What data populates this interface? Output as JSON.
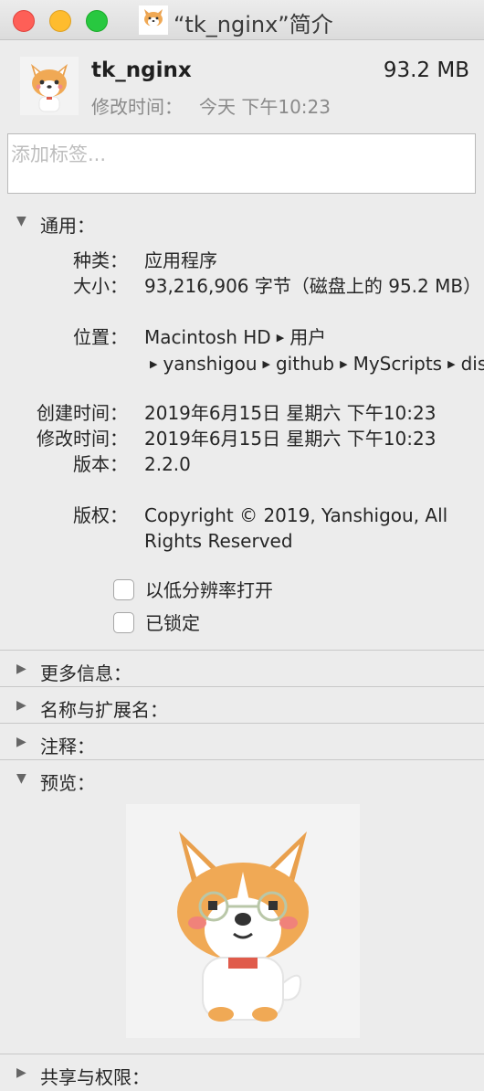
{
  "window": {
    "title": "“tk_nginx”简介"
  },
  "header": {
    "name": "tk_nginx",
    "size": "93.2 MB",
    "modified_label": "修改时间：",
    "modified_value": "今天 下午10:23"
  },
  "tags": {
    "placeholder": "添加标签..."
  },
  "sections": {
    "general": "通用：",
    "more_info": "更多信息：",
    "name_ext": "名称与扩展名：",
    "comments": "注释：",
    "preview": "预览：",
    "sharing": "共享与权限："
  },
  "general": {
    "kind_label": "种类：",
    "kind": "应用程序",
    "size_label": "大小：",
    "size": "93,216,906 字节（磁盘上的 95.2 MB）",
    "where_label": "位置：",
    "where_path": [
      "Macintosh HD",
      "用户",
      "yanshigou",
      "github",
      "MyScripts",
      "dist"
    ],
    "created_label": "创建时间：",
    "created": "2019年6月15日 星期六 下午10:23",
    "modified_label": "修改时间：",
    "modified": "2019年6月15日 星期六 下午10:23",
    "version_label": "版本：",
    "version": "2.2.0",
    "copyright_label": "版权：",
    "copyright": "Copyright © 2019, Yanshigou, All Rights Reserved",
    "low_res_label": "以低分辨率打开",
    "low_res_checked": false,
    "locked_label": "已锁定",
    "locked_checked": false
  },
  "icons": {
    "app": "corgi-app-icon",
    "expanded": "disclosure-down-icon",
    "collapsed": "disclosure-right-icon"
  },
  "colors": {
    "close": "#fe5f57",
    "minimize": "#febc2e",
    "zoom": "#28c840"
  }
}
